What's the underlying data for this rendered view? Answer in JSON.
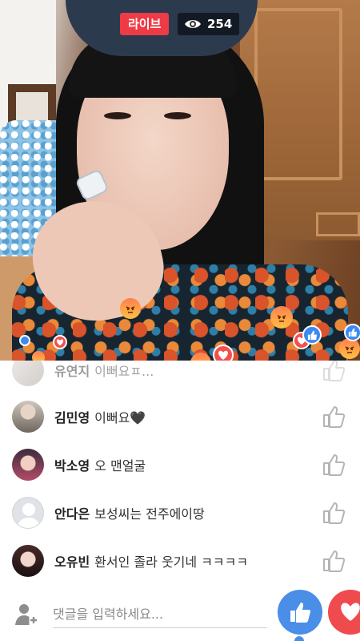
{
  "stream": {
    "live_label": "라이브",
    "viewer_count": "254"
  },
  "comments": [
    {
      "name": "유연지",
      "text": "이뻐요ㅍ...",
      "faded": true
    },
    {
      "name": "김민영",
      "text": "이뻐요🖤"
    },
    {
      "name": "박소영",
      "text": "오 맨얼굴"
    },
    {
      "name": "안다은",
      "text": "보성씨는 전주에이땅"
    },
    {
      "name": "오유빈",
      "text": "환서인 졸라 웃기네 ㅋㅋㅋㅋ"
    }
  ],
  "input": {
    "placeholder": "댓글을 입력하세요..."
  },
  "icons": {
    "viewers": "eye-icon",
    "comment_like": "thumbs-up-outline-icon",
    "user": "user-add-icon",
    "reaction_like": "like-reaction-icon",
    "reaction_love": "love-reaction-icon",
    "reaction_angry": "angry-reaction-icon"
  },
  "colors": {
    "live_red": "#ef3b45",
    "like_blue": "#4a8ee8",
    "love_red": "#ef4b4f"
  }
}
